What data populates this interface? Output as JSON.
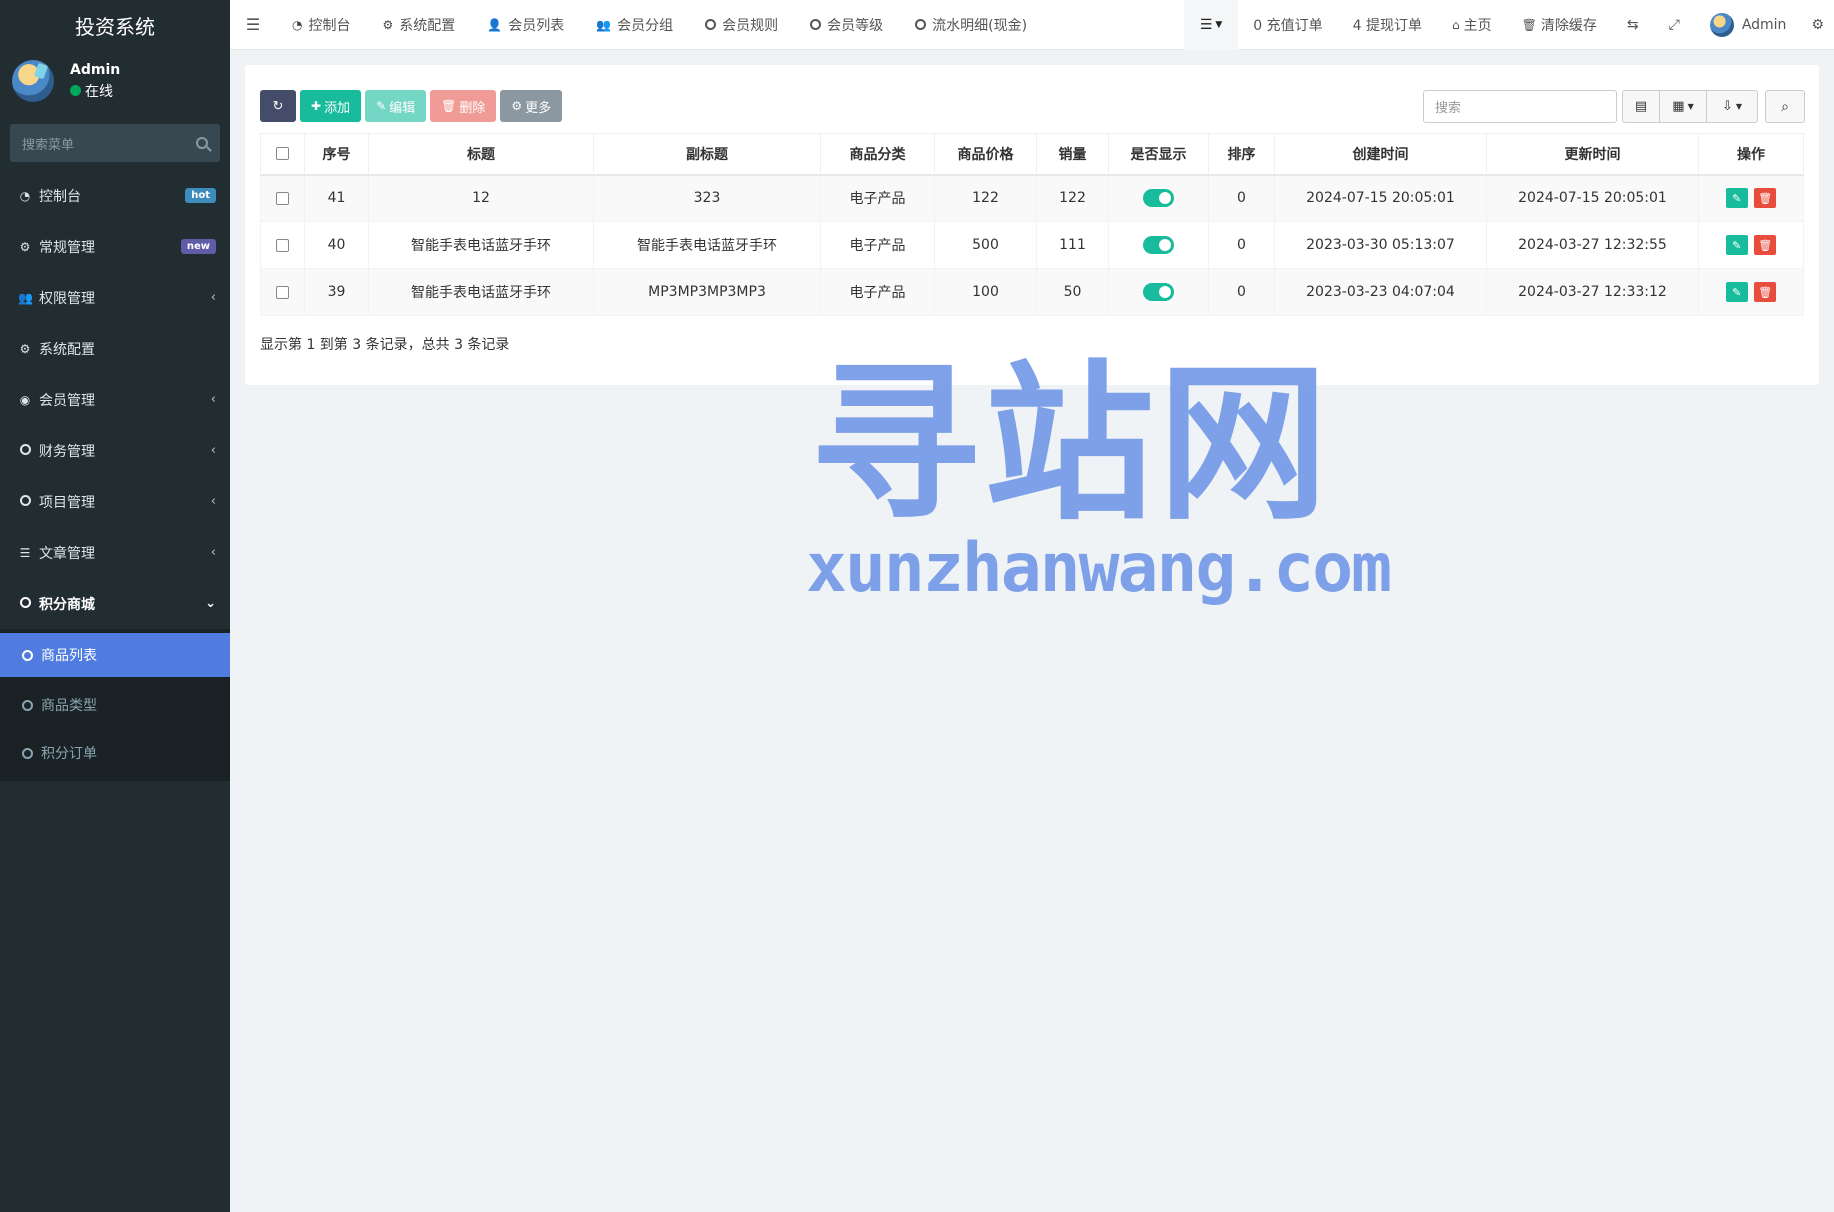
{
  "sidebar": {
    "brand": "投资系统",
    "user_name": "Admin",
    "user_status": "在线",
    "search_placeholder": "搜索菜单",
    "items": [
      {
        "label": "控制台",
        "icon": "dashboard-icon",
        "badge": "hot"
      },
      {
        "label": "常规管理",
        "icon": "cogs-icon",
        "badge": "new"
      },
      {
        "label": "权限管理",
        "icon": "group-icon"
      },
      {
        "label": "系统配置",
        "icon": "gear-icon"
      },
      {
        "label": "会员管理",
        "icon": "user-circle-icon"
      },
      {
        "label": "财务管理",
        "icon": "circle-icon"
      },
      {
        "label": "项目管理",
        "icon": "circle-icon"
      },
      {
        "label": "文章管理",
        "icon": "list-icon"
      },
      {
        "label": "积分商城",
        "icon": "circle-icon"
      }
    ],
    "submenu": [
      {
        "label": "商品列表",
        "active": true
      },
      {
        "label": "商品类型",
        "active": false
      },
      {
        "label": "积分订单",
        "active": false
      }
    ]
  },
  "navbar": {
    "tabs": [
      {
        "label": "控制台",
        "icon": "dashboard-icon"
      },
      {
        "label": "系统配置",
        "icon": "gear-icon"
      },
      {
        "label": "会员列表",
        "icon": "user-icon"
      },
      {
        "label": "会员分组",
        "icon": "users-icon"
      },
      {
        "label": "会员规则",
        "icon": "circle-icon"
      },
      {
        "label": "会员等级",
        "icon": "circle-icon"
      },
      {
        "label": "流水明细(现金)",
        "icon": "circle-icon"
      }
    ],
    "recharge": "0 充值订单",
    "withdraw": "4 提现订单",
    "home": "主页",
    "clear_cache": "清除缓存",
    "admin": "Admin"
  },
  "toolbar": {
    "add": "添加",
    "edit": "编辑",
    "delete": "删除",
    "more": "更多",
    "search_placeholder": "搜索"
  },
  "table": {
    "headers": [
      "序号",
      "标题",
      "副标题",
      "商品分类",
      "商品价格",
      "销量",
      "是否显示",
      "排序",
      "创建时间",
      "更新时间",
      "操作"
    ],
    "rows": [
      {
        "id": "41",
        "title": "12",
        "subtitle": "323",
        "category": "电子产品",
        "price": "122",
        "sales": "122",
        "show": true,
        "sort": "0",
        "created": "2024-07-15 20:05:01",
        "updated": "2024-07-15 20:05:01"
      },
      {
        "id": "40",
        "title": "智能手表电话蓝牙手环",
        "subtitle": "智能手表电话蓝牙手环",
        "category": "电子产品",
        "price": "500",
        "sales": "111",
        "show": true,
        "sort": "0",
        "created": "2023-03-30 05:13:07",
        "updated": "2024-03-27 12:32:55"
      },
      {
        "id": "39",
        "title": "智能手表电话蓝牙手环",
        "subtitle": "MP3MP3MP3MP3",
        "category": "电子产品",
        "price": "100",
        "sales": "50",
        "show": true,
        "sort": "0",
        "created": "2023-03-23 04:07:04",
        "updated": "2024-03-27 12:33:12"
      }
    ]
  },
  "pager": {
    "info": "显示第 1 到第 3 条记录，总共 3 条记录"
  },
  "watermark": {
    "main": "寻站网",
    "sub": "xunzhanwang.com"
  },
  "colors": {
    "sidebar_bg": "#222d32",
    "active_blue": "#4f7cde",
    "success": "#18bc9c",
    "danger": "#e74c3c"
  }
}
